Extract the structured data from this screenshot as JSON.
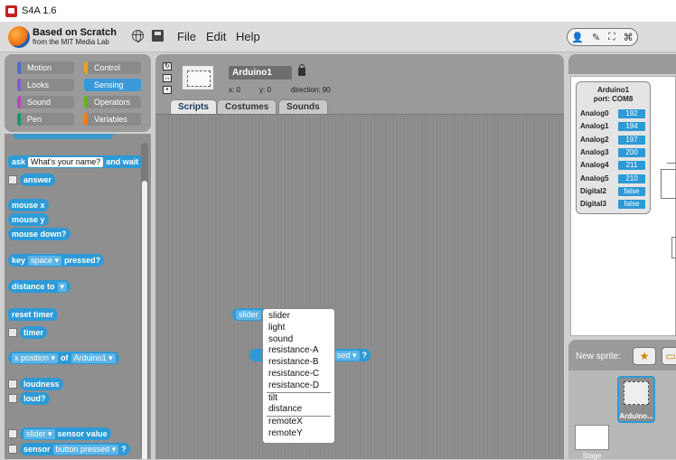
{
  "window": {
    "title": "S4A 1.6"
  },
  "menubar": {
    "brand_line1": "Based on Scratch",
    "brand_line2": "from the MIT Media Lab",
    "menus": [
      "File",
      "Edit",
      "Help"
    ],
    "right_icons": [
      "person-icon",
      "wrench-icon",
      "fullscreen-icon",
      "shrink-icon"
    ]
  },
  "categories": [
    {
      "label": "Motion",
      "color": "#4a6cd4"
    },
    {
      "label": "Control",
      "color": "#e1a91a"
    },
    {
      "label": "Looks",
      "color": "#8a55d7"
    },
    {
      "label": "Sensing",
      "color": "#2d9ad7",
      "selected": true
    },
    {
      "label": "Sound",
      "color": "#bb42c3"
    },
    {
      "label": "Operators",
      "color": "#5cb712"
    },
    {
      "label": "Pen",
      "color": "#0e9a6c"
    },
    {
      "label": "Variables",
      "color": "#ee7d16"
    }
  ],
  "palette": {
    "ask": "ask",
    "ask_default": "What's your name?",
    "and_wait": "and wait",
    "answer": "answer",
    "mouse_x": "mouse x",
    "mouse_y": "mouse y",
    "mouse_down": "mouse down?",
    "key": "key",
    "key_choice": "space",
    "pressed": "pressed?",
    "distance_to": "distance to",
    "reset_timer": "reset timer",
    "timer": "timer",
    "of_attr": "x position",
    "of": "of",
    "of_target": "Arduino1",
    "loudness": "loudness",
    "loud": "loud?",
    "sensor_choice": "slider",
    "sensor_value": "sensor value",
    "sensor": "sensor",
    "sensor_button": "button pressed",
    "q": "?"
  },
  "sprite": {
    "name": "Arduino1",
    "x_label": "x:",
    "x": "0",
    "y_label": "y:",
    "y": "0",
    "direction_label": "direction:",
    "direction": "90"
  },
  "tabs": [
    "Scripts",
    "Costumes",
    "Sounds"
  ],
  "script_blocks": {
    "sensor_value_choice": "slider",
    "sensor_pressed_tail": "sed",
    "q": "?"
  },
  "dropdown": {
    "group1": [
      "slider",
      "light",
      "sound",
      "resistance-A",
      "resistance-B",
      "resistance-C",
      "resistance-D"
    ],
    "group2": [
      "tilt",
      "distance"
    ],
    "group3": [
      "remoteX",
      "remoteY"
    ]
  },
  "sensor_panel": {
    "title": "Arduino1",
    "port": "port: COM8",
    "rows": [
      {
        "name": "Analog0",
        "value": "192"
      },
      {
        "name": "Analog1",
        "value": "194"
      },
      {
        "name": "Analog2",
        "value": "197"
      },
      {
        "name": "Analog3",
        "value": "200"
      },
      {
        "name": "Analog4",
        "value": "211"
      },
      {
        "name": "Analog5",
        "value": "210"
      },
      {
        "name": "Digital2",
        "value": "false"
      },
      {
        "name": "Digital3",
        "value": "false"
      }
    ]
  },
  "sprites_pane": {
    "new_sprite": "New sprite:",
    "sprite_name": "Arduino...",
    "stage_label": "Stage"
  }
}
